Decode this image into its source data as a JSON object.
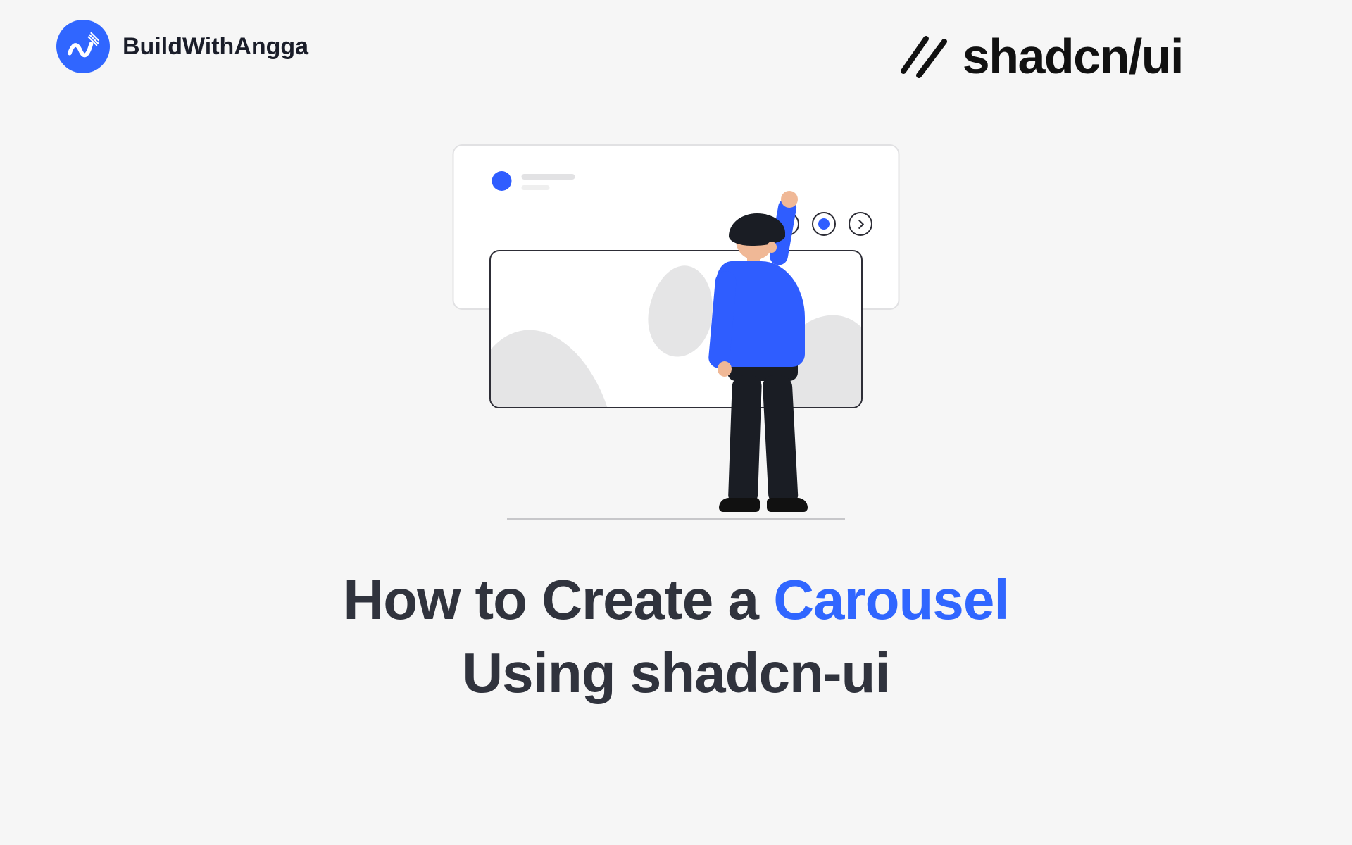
{
  "brand_left": {
    "name": "BuildWithAngga"
  },
  "brand_right": {
    "name": "shadcn/ui"
  },
  "headline": {
    "part1": "How to Create a ",
    "accent": "Carousel",
    "part2": "Using shadcn-ui"
  },
  "colors": {
    "accent": "#3066ff",
    "text": "#30333d"
  }
}
